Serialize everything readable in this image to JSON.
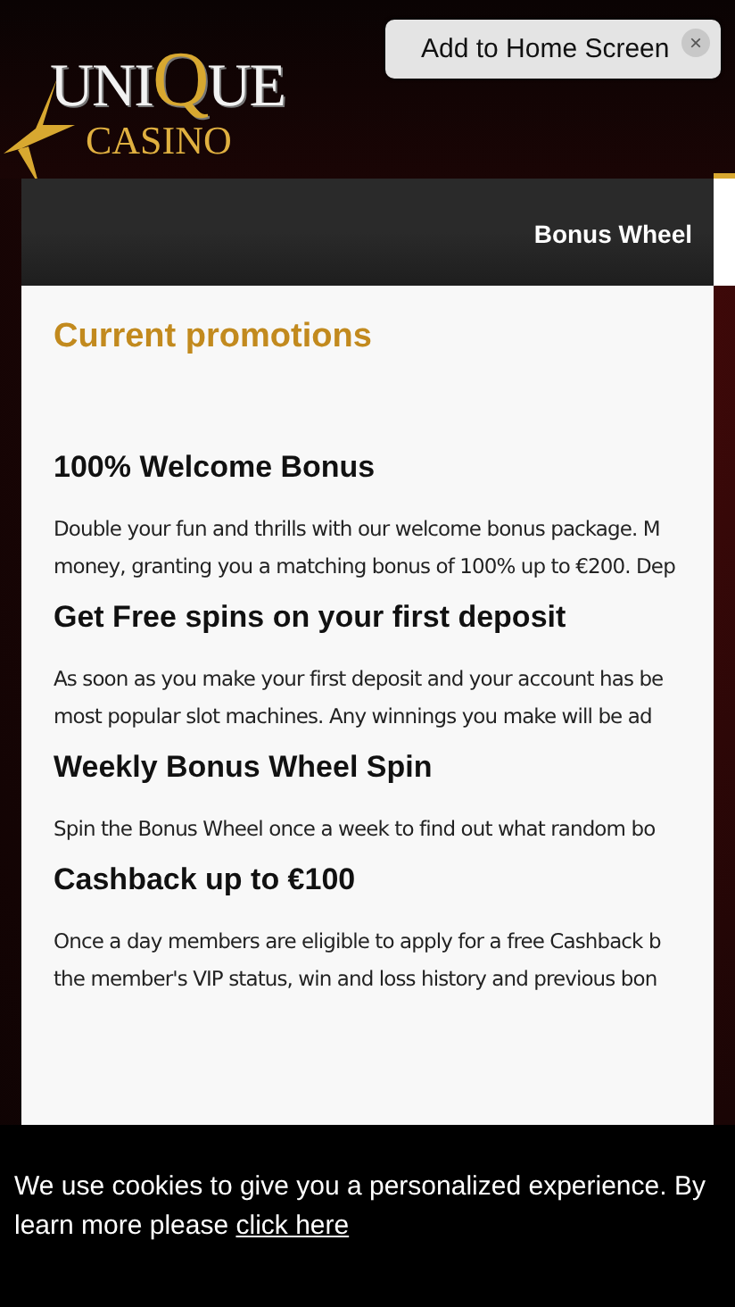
{
  "header": {
    "logo": {
      "word_parts": [
        "UNI",
        "Q",
        "UE"
      ],
      "subtitle": "CASINO"
    },
    "install_prompt": {
      "label": "Add to Home Screen",
      "close": "×"
    }
  },
  "tab_bar": {
    "label": "Bonus Wheel"
  },
  "promotions": {
    "title": "Current promotions",
    "items": [
      {
        "heading": "100% Welcome Bonus",
        "lines": [
          "Double your fun and thrills with our welcome bonus package. M",
          "money, granting you a matching bonus of 100% up to €200. Dep"
        ]
      },
      {
        "heading": "Get Free spins on your first deposit",
        "lines": [
          "As soon as you make your first deposit and your account has be",
          "most popular slot machines. Any winnings you make will be ad"
        ]
      },
      {
        "heading": "Weekly Bonus Wheel Spin",
        "lines": [
          "Spin the Bonus Wheel once a week to find out what random bo"
        ]
      },
      {
        "heading": "Cashback up to €100",
        "lines": [
          "Once a day members are eligible to apply for a free Cashback b",
          "the member's VIP status, win and loss history and previous bon"
        ]
      }
    ]
  },
  "cookie_banner": {
    "lines": [
      "We use cookies to give you a personalized experience. By"
    ],
    "lead": "learn more please ",
    "link": "click here"
  }
}
